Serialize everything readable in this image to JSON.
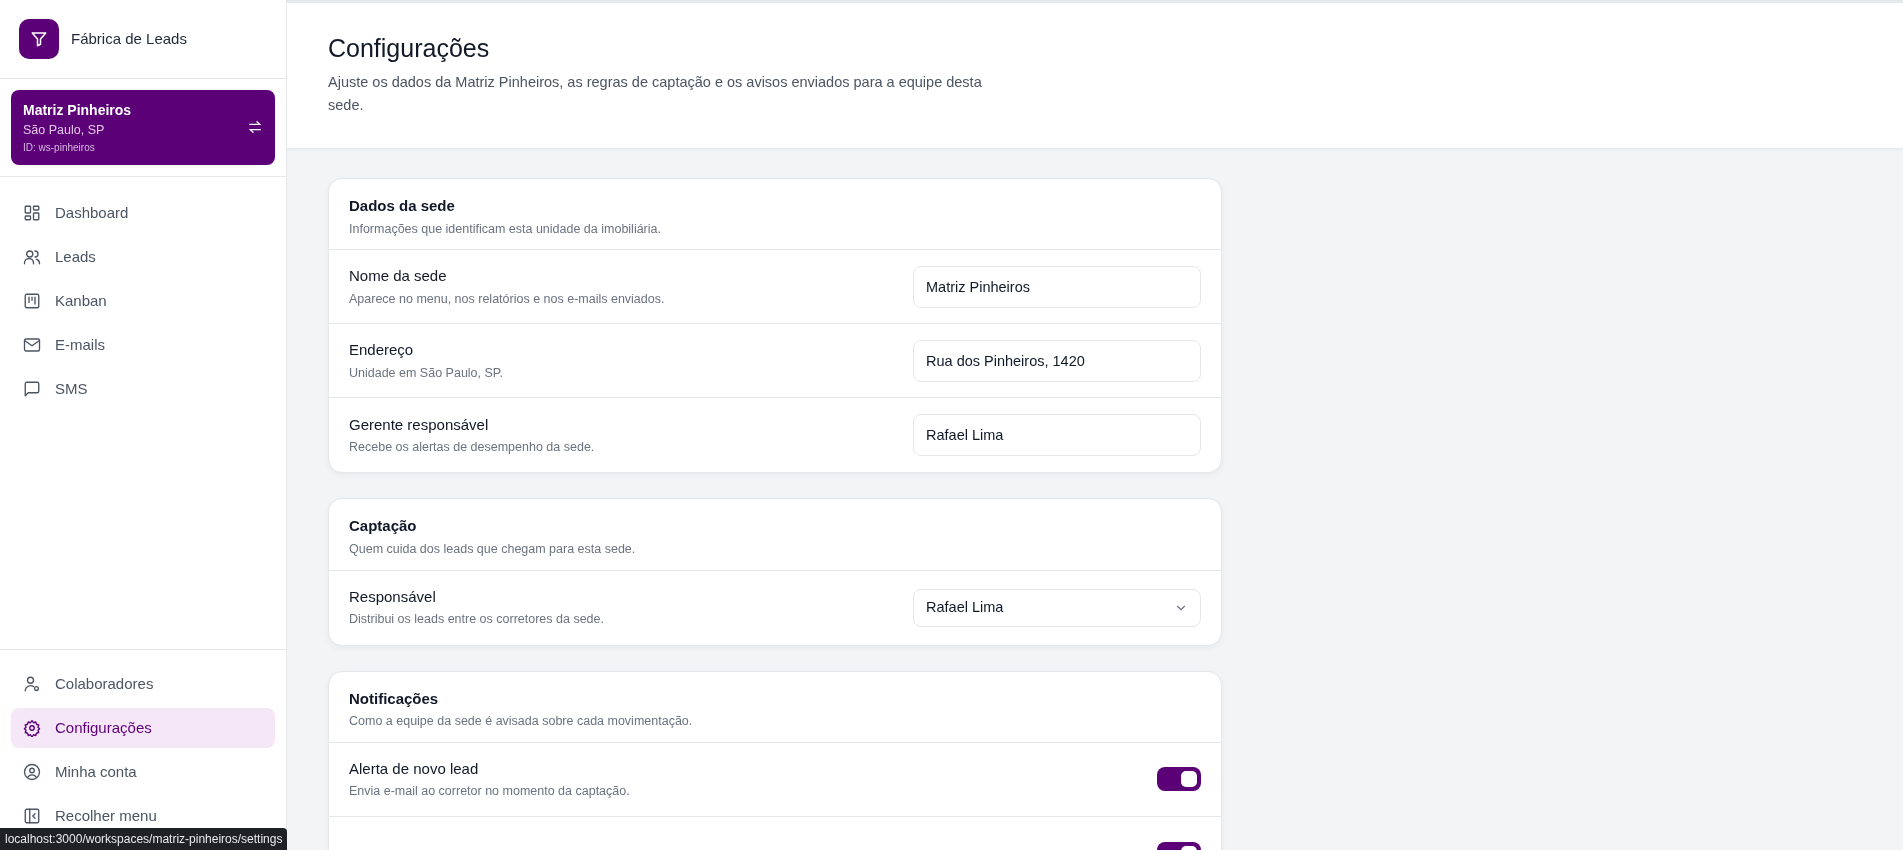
{
  "brand": {
    "name": "Fábrica de Leads"
  },
  "workspace": {
    "name": "Matriz Pinheiros",
    "location": "São Paulo, SP",
    "id": "ID: ws-pinheiros"
  },
  "nav": {
    "items": [
      {
        "label": "Dashboard",
        "selected": false
      },
      {
        "label": "Leads",
        "selected": false
      },
      {
        "label": "Kanban",
        "selected": false
      },
      {
        "label": "E-mails",
        "selected": false
      },
      {
        "label": "SMS",
        "selected": false
      }
    ]
  },
  "footer_nav": {
    "items": [
      {
        "label": "Colaboradores",
        "selected": false
      },
      {
        "label": "Configurações",
        "selected": true
      },
      {
        "label": "Minha conta",
        "selected": false
      },
      {
        "label": "Recolher menu",
        "selected": false
      }
    ]
  },
  "header": {
    "title": "Configurações",
    "description": "Ajuste os dados da Matriz Pinheiros, as regras de captação e os avisos enviados para a equipe desta sede."
  },
  "sections": [
    {
      "title": "Dados da sede",
      "description": "Informações que identificam esta unidade da imobiliária.",
      "rows": [
        {
          "kind": "text",
          "label": "Nome da sede",
          "hint": "Aparece no menu, nos relatórios e nos e-mails enviados.",
          "value": "Matriz Pinheiros"
        },
        {
          "kind": "text",
          "label": "Endereço",
          "hint": "Unidade em São Paulo, SP.",
          "value": "Rua dos Pinheiros, 1420"
        },
        {
          "kind": "text",
          "label": "Gerente responsável",
          "hint": "Recebe os alertas de desempenho da sede.",
          "value": "Rafael Lima"
        }
      ]
    },
    {
      "title": "Captação",
      "description": "Quem cuida dos leads que chegam para esta sede.",
      "rows": [
        {
          "kind": "select",
          "label": "Responsável",
          "hint": "Distribui os leads entre os corretores da sede.",
          "value": "Rafael Lima"
        }
      ]
    },
    {
      "title": "Notificações",
      "description": "Como a equipe da sede é avisada sobre cada movimentação.",
      "rows": [
        {
          "kind": "toggle",
          "label": "Alerta de novo lead",
          "hint": "Envia e-mail ao corretor no momento da captação.",
          "on": true
        },
        {
          "kind": "toggle",
          "on": true
        }
      ]
    }
  ],
  "status_bar": {
    "url": "localhost:3000/workspaces/matriz-pinheiros/settings"
  }
}
